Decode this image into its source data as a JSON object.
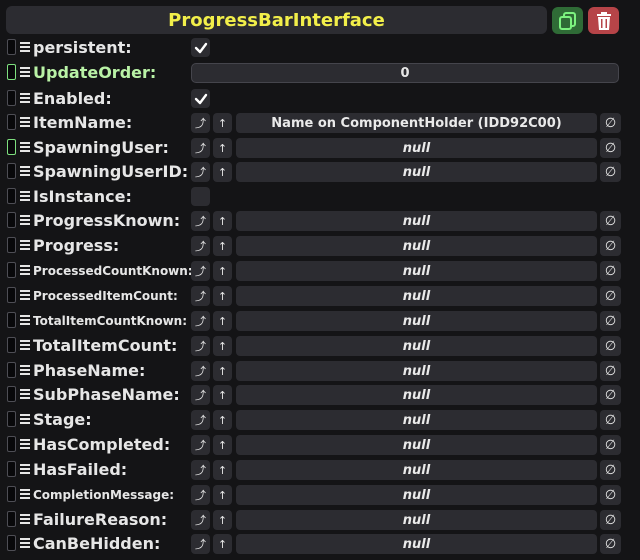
{
  "header": {
    "title": "ProgressBarInterface",
    "copy_icon": "copy-icon",
    "delete_icon": "trash-icon",
    "colors": {
      "title": "#f2ef4a",
      "copy": "#2f6b36",
      "delete": "#b64448"
    }
  },
  "fields": [
    {
      "label": "persistent:",
      "kind": "check",
      "checked": true
    },
    {
      "label": "UpdateOrder:",
      "kind": "number",
      "value": "0",
      "highlight": true
    },
    {
      "label": "Enabled:",
      "kind": "check",
      "checked": true
    },
    {
      "label": "ItemName:",
      "kind": "ref",
      "value": "Name on ComponentHolder (IDD92C00)"
    },
    {
      "label": "SpawningUser:",
      "kind": "ref",
      "value": "null",
      "grip_green": true
    },
    {
      "label": "SpawningUserID:",
      "kind": "ref",
      "value": "null"
    },
    {
      "label": "IsInstance:",
      "kind": "check",
      "checked": false
    },
    {
      "label": "ProgressKnown:",
      "kind": "ref",
      "value": "null"
    },
    {
      "label": "Progress:",
      "kind": "ref",
      "value": "null"
    },
    {
      "label": "ProcessedCountKnown:",
      "kind": "ref",
      "value": "null",
      "small": true
    },
    {
      "label": "ProcessedItemCount:",
      "kind": "ref",
      "value": "null",
      "small": true
    },
    {
      "label": "TotalItemCountKnown:",
      "kind": "ref",
      "value": "null",
      "small": true
    },
    {
      "label": "TotalItemCount:",
      "kind": "ref",
      "value": "null"
    },
    {
      "label": "PhaseName:",
      "kind": "ref",
      "value": "null"
    },
    {
      "label": "SubPhaseName:",
      "kind": "ref",
      "value": "null"
    },
    {
      "label": "Stage:",
      "kind": "ref",
      "value": "null"
    },
    {
      "label": "HasCompleted:",
      "kind": "ref",
      "value": "null"
    },
    {
      "label": "HasFailed:",
      "kind": "ref",
      "value": "null"
    },
    {
      "label": "CompletionMessage:",
      "kind": "ref",
      "value": "null",
      "small": true
    },
    {
      "label": "FailureReason:",
      "kind": "ref",
      "value": "null"
    },
    {
      "label": "CanBeHidden:",
      "kind": "ref",
      "value": "null"
    }
  ],
  "icons": {
    "grip": "drag-handle-icon",
    "menu": "hamburger-icon",
    "jump": "jump-to-icon",
    "up": "arrow-up-icon",
    "clear": "clear-null-icon"
  },
  "glyphs": {
    "jump": "⤴",
    "up": "↑",
    "clear": "∅"
  }
}
